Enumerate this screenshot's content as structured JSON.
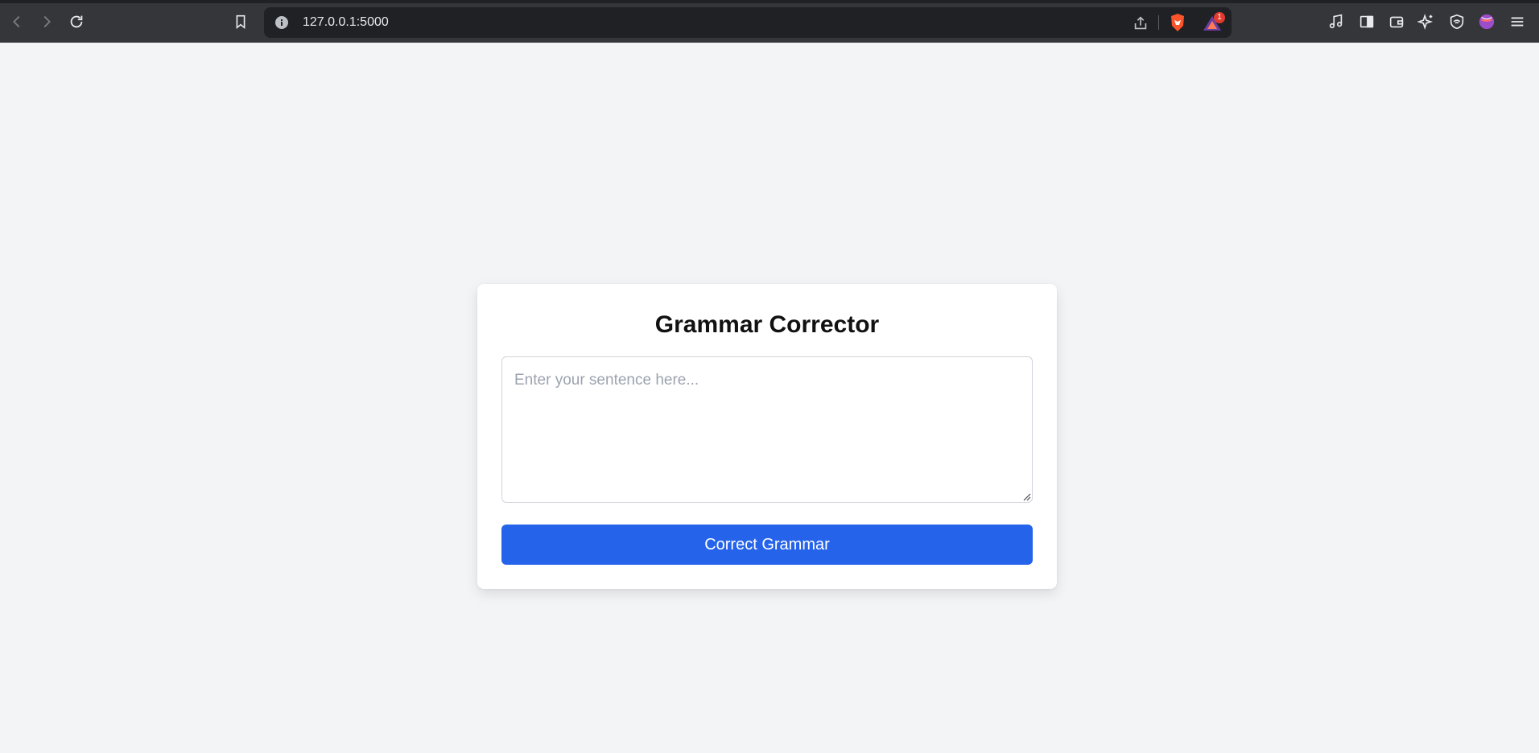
{
  "browser": {
    "url": "127.0.0.1:5000",
    "rewards_badge_count": "1",
    "icons": [
      "back-icon",
      "forward-icon",
      "reload-icon",
      "bookmark-icon",
      "info-icon",
      "share-icon",
      "brave-shields-icon",
      "brave-rewards-icon",
      "music-icon",
      "sidebar-icon",
      "wallet-icon",
      "leo-ai-icon",
      "vpn-icon",
      "profile-icon",
      "menu-icon"
    ]
  },
  "app": {
    "title": "Grammar Corrector",
    "input_placeholder": "Enter your sentence here...",
    "input_value": "",
    "submit_label": "Correct Grammar"
  },
  "colors": {
    "page_bg": "#f3f4f6",
    "accent": "#2563eb",
    "card_bg": "#ffffff"
  }
}
